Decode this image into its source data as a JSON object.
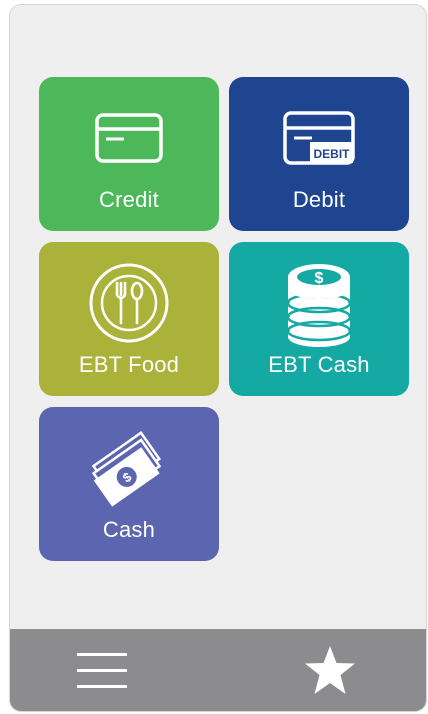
{
  "tiles": [
    {
      "id": "credit",
      "label": "Credit",
      "color": "#4cb85a",
      "icon": "credit-card-icon"
    },
    {
      "id": "debit",
      "label": "Debit",
      "color": "#1f4591",
      "icon": "debit-card-icon",
      "icon_text": "DEBIT"
    },
    {
      "id": "ebt_food",
      "label": "EBT Food",
      "color": "#aab23a",
      "icon": "plate-utensils-icon"
    },
    {
      "id": "ebt_cash",
      "label": "EBT Cash",
      "color": "#14a9a3",
      "icon": "coin-stack-icon",
      "icon_text": "$"
    },
    {
      "id": "cash",
      "label": "Cash",
      "color": "#5c66b0",
      "icon": "banknotes-icon",
      "icon_text": "$"
    }
  ],
  "bottom_bar": {
    "color": "#8c8c8e",
    "menu_icon": "hamburger-menu-icon",
    "favorites_icon": "star-icon"
  }
}
